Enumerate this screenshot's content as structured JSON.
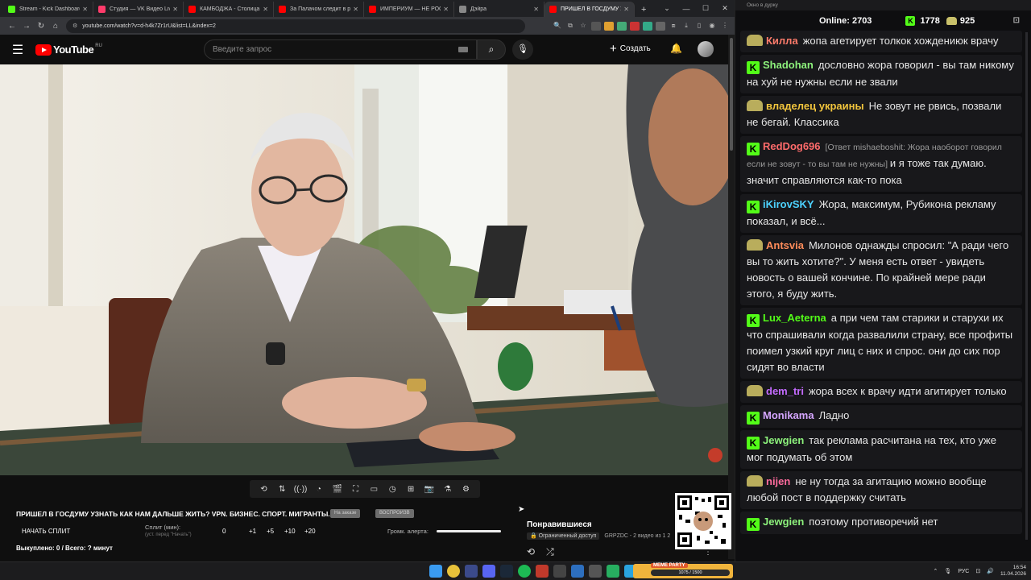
{
  "browser": {
    "tabs": [
      {
        "title": "Stream - Kick Dashboard",
        "color": "#53fc18"
      },
      {
        "title": "Студия — VK Видео Live",
        "color": "#ff3b6b"
      },
      {
        "title": "КАМБОДЖА - Столица Мир",
        "color": "#ff0000"
      },
      {
        "title": "За Палачом следит в реал",
        "color": "#ff0000"
      },
      {
        "title": "ИМПЕРИУМ — НЕ РОССИ",
        "color": "#ff0000"
      },
      {
        "title": "Дэйра",
        "color": "#888888"
      },
      {
        "title": "ПРИШЕЛ В ГОСДУМУ У",
        "color": "#ff0000"
      }
    ],
    "url": "youtube.com/watch?v=d-h4k7Zr1rU&list=LL&index=2"
  },
  "youtube": {
    "logo": "YouTube",
    "region": "RU",
    "search_placeholder": "Введите запрос",
    "create_label": "Создать"
  },
  "video": {
    "title": "ПРИШЕЛ В ГОСДУМУ УЗНАТЬ КАК НАМ ДАЛЬШЕ ЖИТЬ? VPN. БИЗНЕС. СПОРТ. МИГРАНТЫ.",
    "pill1": "На заказе",
    "pill2": "ВОСПРОИЗВ"
  },
  "split": {
    "start_label": "НАЧАТЬ СПЛИТ",
    "label": "Сплит (мин):",
    "hint": "(уст. перед \"Начать\")",
    "value": "0",
    "increments": [
      "+1",
      "+5",
      "+10",
      "+20"
    ],
    "alert_volume_label": "Громк. алерта:",
    "alert_volume_level": 1.0,
    "bought": "Выкуплено: 0 / Всего: ? минут"
  },
  "playlist": {
    "title": "Понравившиеся",
    "access": "Ограниченный доступ",
    "meta": "GRPZDC - 2 видео из 1 2"
  },
  "chat": {
    "window_title": "Окно в дурку",
    "online_label": "Online:",
    "online_count": "2703",
    "kick_points": "1778",
    "pepe_points": "925",
    "messages": [
      {
        "badge": "pepe",
        "user": "Килла",
        "color": "#ff7b6b",
        "text": "жопа агетирует толкок хождениюк врачу",
        "reply": ""
      },
      {
        "badge": "kick",
        "user": "Shadohan",
        "color": "#8df27c",
        "text": "дословно жора говорил - вы там никому на хуй не нужны если не звали",
        "reply": ""
      },
      {
        "badge": "pepe",
        "user": "владелец украины",
        "color": "#f2c53d",
        "text": "Не зовут не рвись, позвали не бегай. Классика",
        "reply": ""
      },
      {
        "badge": "kick",
        "user": "RedDog696",
        "color": "#ff6b6b",
        "text": "и я тоже так думаю. значит справляются как-то пока",
        "reply": "[Ответ mishaeboshit: Жора наоборот говорил если не зовут - то вы там не нужны]"
      },
      {
        "badge": "kick",
        "user": "iKirovSKY",
        "color": "#4dd2ff",
        "text": "Жора, максимум, Рубикона рекламу показал, и всё...",
        "reply": ""
      },
      {
        "badge": "pepe",
        "user": "Antsvia",
        "color": "#ff8c5a",
        "text": "Милонов однажды спросил: \"А ради чего вы то жить хотите?\". У меня есть ответ - увидеть новость о вашей кончине. По крайней мере ради этого, я буду жить.",
        "reply": ""
      },
      {
        "badge": "kick",
        "user": "Lux_Aeterna",
        "color": "#53fc18",
        "text": "а при чем там старики и старухи их что спрашивали когда развалили страну, все профиты поимел узкий круг лиц с них и спрос. они до сих пор сидят во власти",
        "reply": ""
      },
      {
        "badge": "pepe",
        "user": "dem_tri",
        "color": "#c46bff",
        "text": "жора всех к врачу идти агитирует только",
        "reply": ""
      },
      {
        "badge": "kick",
        "user": "Monikama",
        "color": "#d5a6ff",
        "text": "Ладно",
        "reply": ""
      },
      {
        "badge": "kick",
        "user": "Jewgien",
        "color": "#8df27c",
        "text": "так реклама расчитана на тех, кто уже мог подумать об этом",
        "reply": ""
      },
      {
        "badge": "pepe",
        "user": "nijen",
        "color": "#ff6b9d",
        "text": "не ну тогда за агитацию можно вообще любой пост в поддержку считать",
        "reply": ""
      },
      {
        "badge": "kick",
        "user": "Jewgien",
        "color": "#8df27c",
        "text": "поэтому противоречий нет",
        "reply": ""
      }
    ]
  },
  "taskbar": {
    "meme_label": "MEME PARTY",
    "meme_progress": "1075 / 1500",
    "lang": "РУС",
    "time": "16:54",
    "date": "11.04.2026"
  }
}
